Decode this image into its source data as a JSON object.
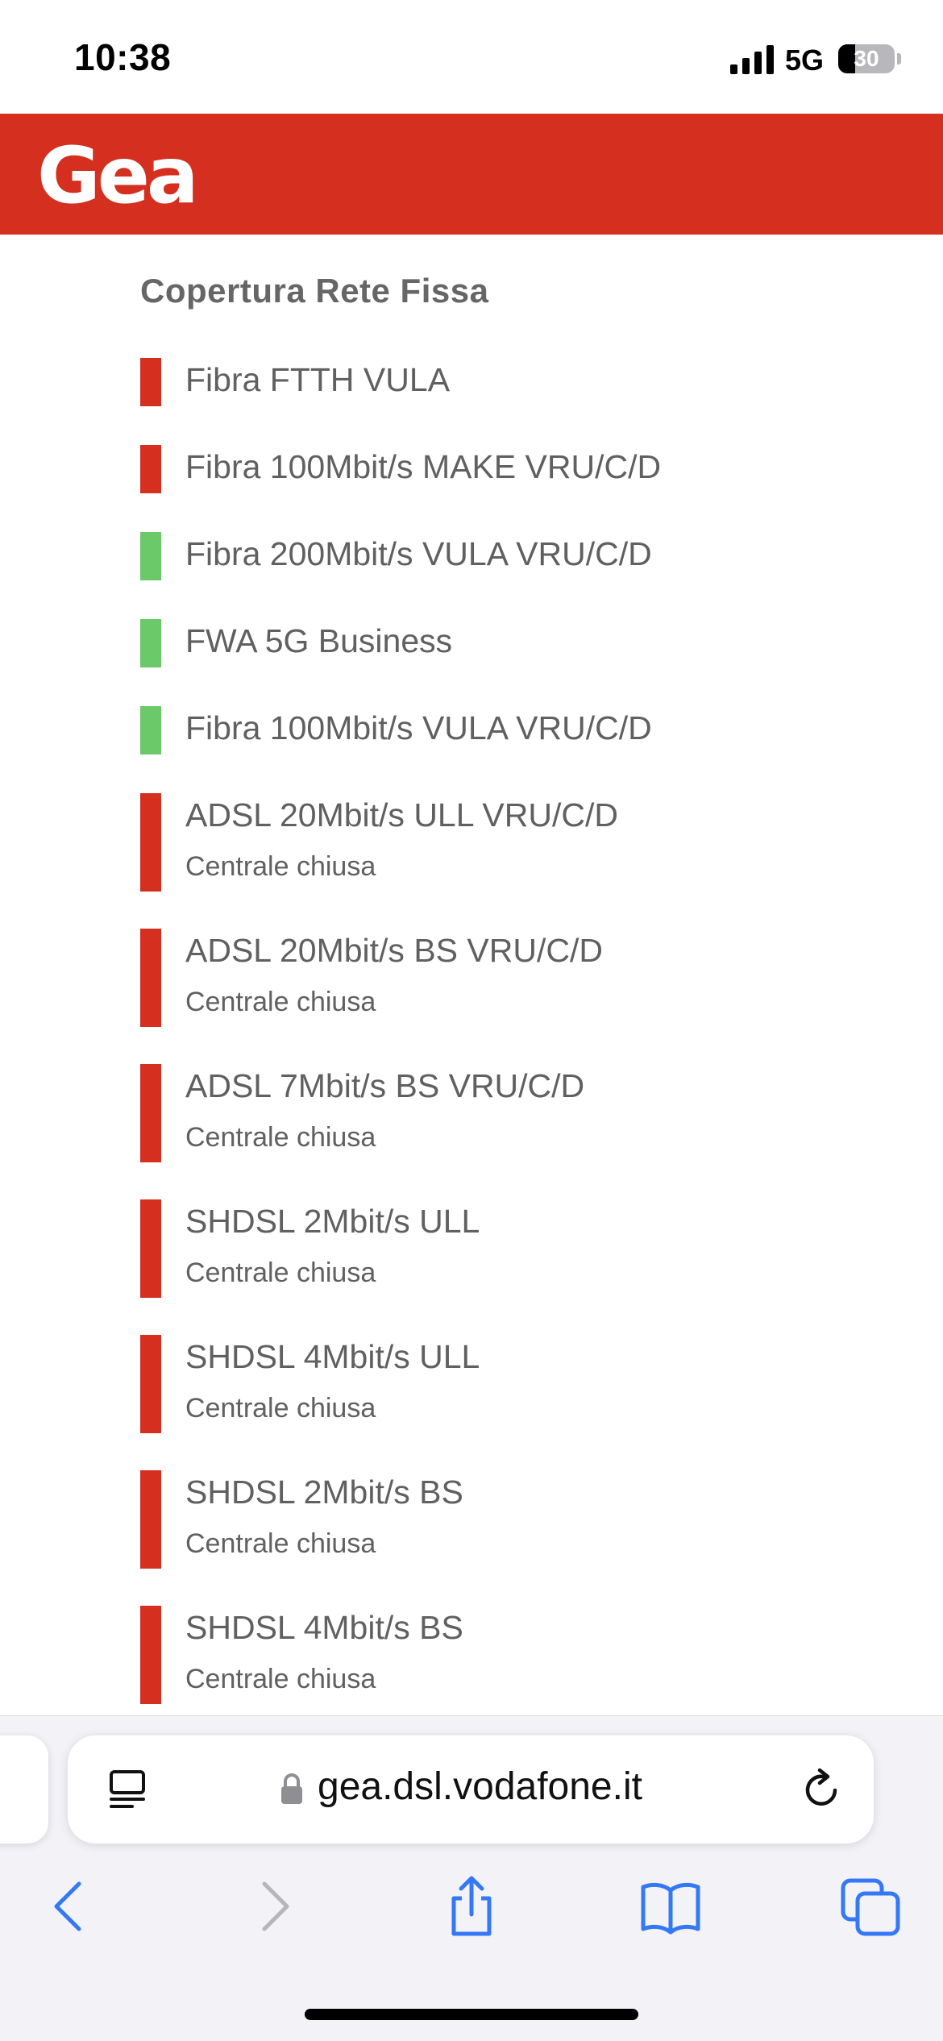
{
  "status_bar": {
    "time": "10:38",
    "network": "5G",
    "battery_level": "30",
    "battery_fraction": 0.3
  },
  "brand": {
    "logo_text": "Gea",
    "color": "#d42f1f"
  },
  "coverage": {
    "title": "Copertura Rete Fissa",
    "colors": {
      "unavailable": "#d42f1f",
      "available": "#6cc96a"
    },
    "services": [
      {
        "name": "Fibra FTTH VULA",
        "available": false,
        "status": ""
      },
      {
        "name": "Fibra 100Mbit/s MAKE VRU/C/D",
        "available": false,
        "status": ""
      },
      {
        "name": "Fibra 200Mbit/s VULA VRU/C/D",
        "available": true,
        "status": ""
      },
      {
        "name": "FWA 5G Business",
        "available": true,
        "status": ""
      },
      {
        "name": "Fibra 100Mbit/s VULA VRU/C/D",
        "available": true,
        "status": ""
      },
      {
        "name": "ADSL 20Mbit/s ULL VRU/C/D",
        "available": false,
        "status": "Centrale chiusa"
      },
      {
        "name": "ADSL 20Mbit/s BS VRU/C/D",
        "available": false,
        "status": "Centrale chiusa"
      },
      {
        "name": "ADSL 7Mbit/s BS VRU/C/D",
        "available": false,
        "status": "Centrale chiusa"
      },
      {
        "name": "SHDSL 2Mbit/s ULL",
        "available": false,
        "status": "Centrale chiusa"
      },
      {
        "name": "SHDSL 4Mbit/s ULL",
        "available": false,
        "status": "Centrale chiusa"
      },
      {
        "name": "SHDSL 2Mbit/s BS",
        "available": false,
        "status": "Centrale chiusa"
      },
      {
        "name": "SHDSL 4Mbit/s BS",
        "available": false,
        "status": "Centrale chiusa"
      }
    ]
  },
  "browser": {
    "url": "gea.dsl.vodafone.it",
    "icons": [
      "reader-icon",
      "lock-icon",
      "reload-icon",
      "back-icon",
      "forward-icon",
      "share-icon",
      "bookmarks-icon",
      "tabs-icon"
    ],
    "accent": "#3478f6"
  }
}
